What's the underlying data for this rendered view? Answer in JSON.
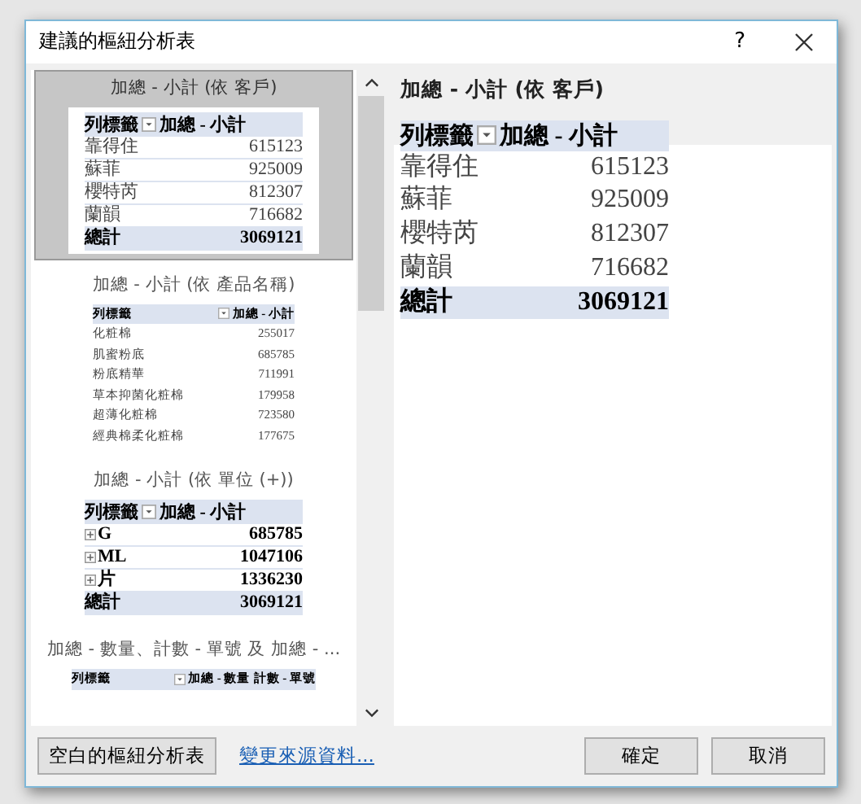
{
  "window": {
    "title": "建議的樞紐分析表",
    "help": "?"
  },
  "recommendations": [
    {
      "caption": "加總 - 小計 (依 客戶)",
      "selected": true,
      "kind": "large",
      "header": [
        "列標籤",
        "加總 - 小計"
      ],
      "rows": [
        {
          "kind": "plain",
          "label": "靠得住",
          "value": "615123"
        },
        {
          "kind": "plain",
          "label": "蘇菲",
          "value": "925009"
        },
        {
          "kind": "plain",
          "label": "櫻特芮",
          "value": "812307"
        },
        {
          "kind": "plain",
          "label": "蘭韻",
          "value": "716682"
        }
      ],
      "total": [
        "總計",
        "3069121"
      ]
    },
    {
      "caption": "加總 - 小計 (依 產品名稱)",
      "selected": false,
      "kind": "small",
      "header": [
        "列標籤",
        "加總 - 小計"
      ],
      "rows": [
        {
          "kind": "plain",
          "label": "化粧棉",
          "value": "255017"
        },
        {
          "kind": "plain",
          "label": "肌蜜粉底",
          "value": "685785"
        },
        {
          "kind": "plain",
          "label": "粉底精華",
          "value": "711991"
        },
        {
          "kind": "plain",
          "label": "草本抑菌化粧棉",
          "value": "179958"
        },
        {
          "kind": "plain",
          "label": "超薄化粧棉",
          "value": "723580"
        },
        {
          "kind": "plain",
          "label": "經典棉柔化粧棉",
          "value": "177675"
        }
      ]
    },
    {
      "caption": "加總 - 小計 (依 單位 (+))",
      "selected": false,
      "kind": "large",
      "header": [
        "列標籤",
        "加總 - 小計"
      ],
      "rows": [
        {
          "kind": "expandable",
          "label": "G",
          "value": "685785"
        },
        {
          "kind": "expandable",
          "label": "ML",
          "value": "1047106"
        },
        {
          "kind": "expandable",
          "label": "片",
          "value": "1336230"
        }
      ],
      "total": [
        "總計",
        "3069121"
      ]
    },
    {
      "caption": "加總 - 數量、計數 - 單號 及 加總 - ...",
      "selected": false,
      "kind": "small",
      "header": [
        "列標籤",
        "加總 - 數量",
        "計數 - 單號"
      ]
    }
  ],
  "preview": {
    "caption": "加總 - 小計 (依 客戶)",
    "header": [
      "列標籤",
      "加總 - 小計"
    ],
    "rows": [
      {
        "label": "靠得住",
        "value": "615123"
      },
      {
        "label": "蘇菲",
        "value": "925009"
      },
      {
        "label": "櫻特芮",
        "value": "812307"
      },
      {
        "label": "蘭韻",
        "value": "716682"
      }
    ],
    "total": [
      "總計",
      "3069121"
    ]
  },
  "buttons": {
    "blank": "空白的樞紐分析表",
    "link": "變更來源資料...",
    "ok": "確定",
    "cancel": "取消"
  }
}
